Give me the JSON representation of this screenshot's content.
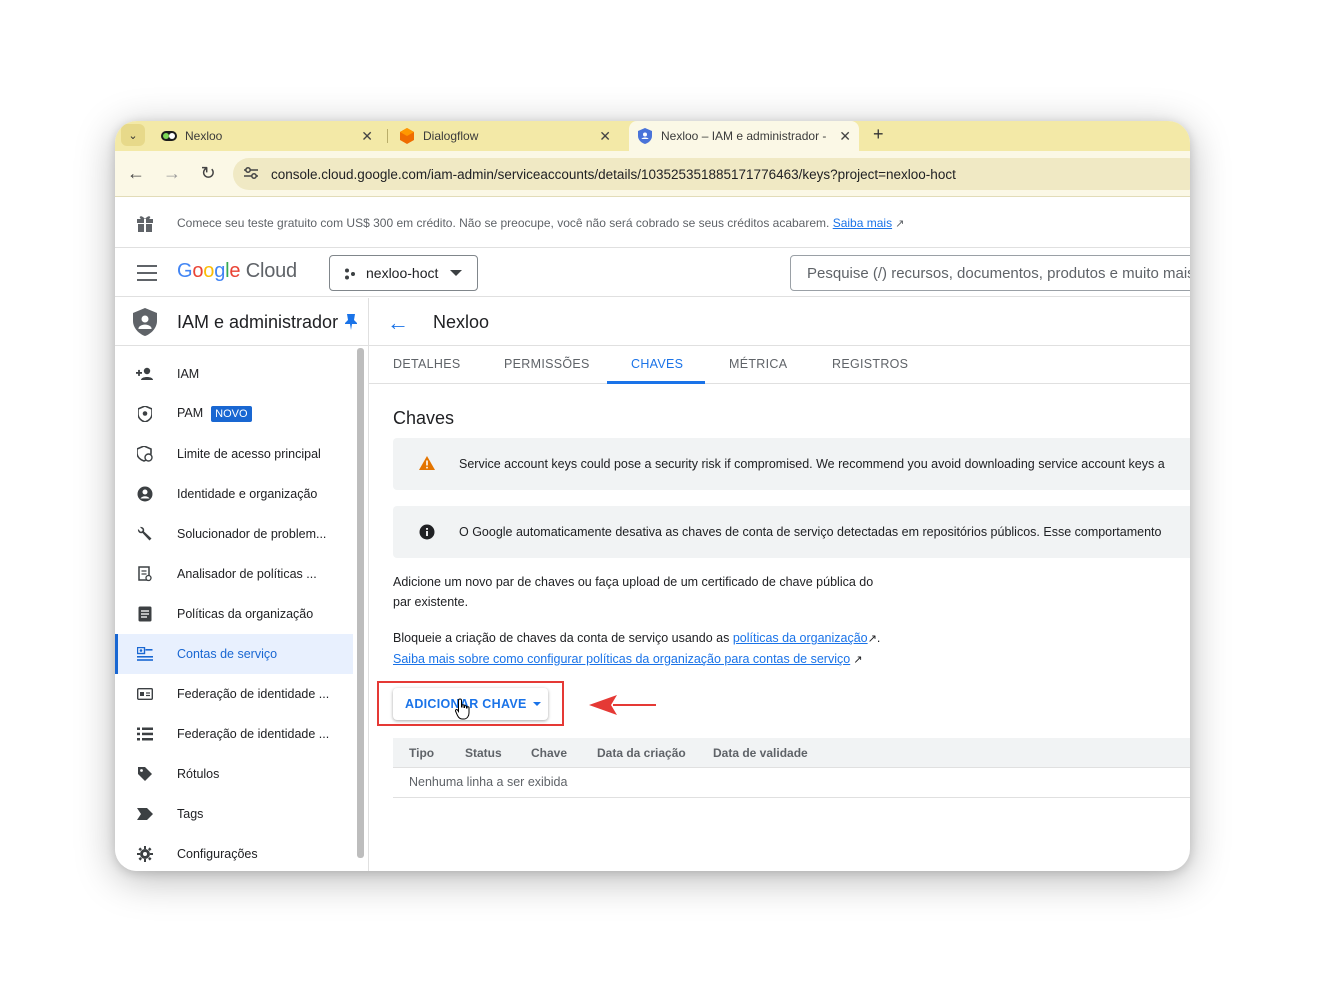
{
  "browser": {
    "tabs": [
      {
        "title": "Nexloo",
        "active": false
      },
      {
        "title": "Dialogflow",
        "active": false
      },
      {
        "title": "Nexloo – IAM e administrador -",
        "active": true
      }
    ],
    "url": "console.cloud.google.com/iam-admin/serviceaccounts/details/103525351885171776463/keys?project=nexloo-hoct"
  },
  "promo": {
    "text": "Comece seu teste gratuito com US$ 300 em crédito. Não se preocupe, você não será cobrado se seus créditos acabarem.",
    "link": "Saiba mais"
  },
  "header": {
    "logo_google": "Google",
    "logo_cloud": "Cloud",
    "project": "nexloo-hoct",
    "search_placeholder": "Pesquise (/) recursos, documentos, produtos e muito mais"
  },
  "sidebar": {
    "title": "IAM e administrador",
    "items": [
      {
        "label": "IAM",
        "icon": "person-add-icon"
      },
      {
        "label": "PAM",
        "icon": "shield-lock-icon",
        "badge": "NOVO"
      },
      {
        "label": "Limite de acesso principal",
        "icon": "principal-access-icon"
      },
      {
        "label": "Identidade e organização",
        "icon": "account-circle-icon"
      },
      {
        "label": "Solucionador de problem...",
        "icon": "wrench-icon"
      },
      {
        "label": "Analisador de políticas ...",
        "icon": "policy-analyzer-icon"
      },
      {
        "label": "Políticas da organização",
        "icon": "document-icon"
      },
      {
        "label": "Contas de serviço",
        "icon": "service-account-icon",
        "active": true
      },
      {
        "label": "Federação de identidade ...",
        "icon": "id-card-icon"
      },
      {
        "label": "Federação de identidade ...",
        "icon": "list-icon"
      },
      {
        "label": "Rótulos",
        "icon": "label-icon"
      },
      {
        "label": "Tags",
        "icon": "tag-icon"
      },
      {
        "label": "Configurações",
        "icon": "gear-icon"
      }
    ]
  },
  "main": {
    "title": "Nexloo",
    "tabs": [
      "DETALHES",
      "PERMISSÕES",
      "CHAVES",
      "MÉTRICA",
      "REGISTROS"
    ],
    "active_tab": "CHAVES",
    "section_title": "Chaves",
    "warning": "Service account keys could pose a security risk if compromised. We recommend you avoid downloading service account keys a",
    "info": "O Google automaticamente desativa as chaves de conta de serviço detectadas em repositórios públicos. Esse comportamento",
    "para1_line1": "Adicione um novo par de chaves ou faça upload de um certificado de chave pública do",
    "para1_line2": "par existente.",
    "para2_prefix": "Bloqueie a criação de chaves da conta de serviço usando as ",
    "para2_link": "políticas da organização",
    "para2_suffix": ".",
    "para3_link": "Saiba mais sobre como configurar políticas da organização para contas de serviço",
    "add_key_button": "ADICIONAR CHAVE",
    "table_columns": [
      "Tipo",
      "Status",
      "Chave",
      "Data da criação",
      "Data de validade"
    ],
    "empty_text": "Nenhuma linha a ser exibida"
  },
  "colors": {
    "accent": "#1a73e8",
    "annotation": "#e53935",
    "tabstrip": "#f3e9a7"
  }
}
